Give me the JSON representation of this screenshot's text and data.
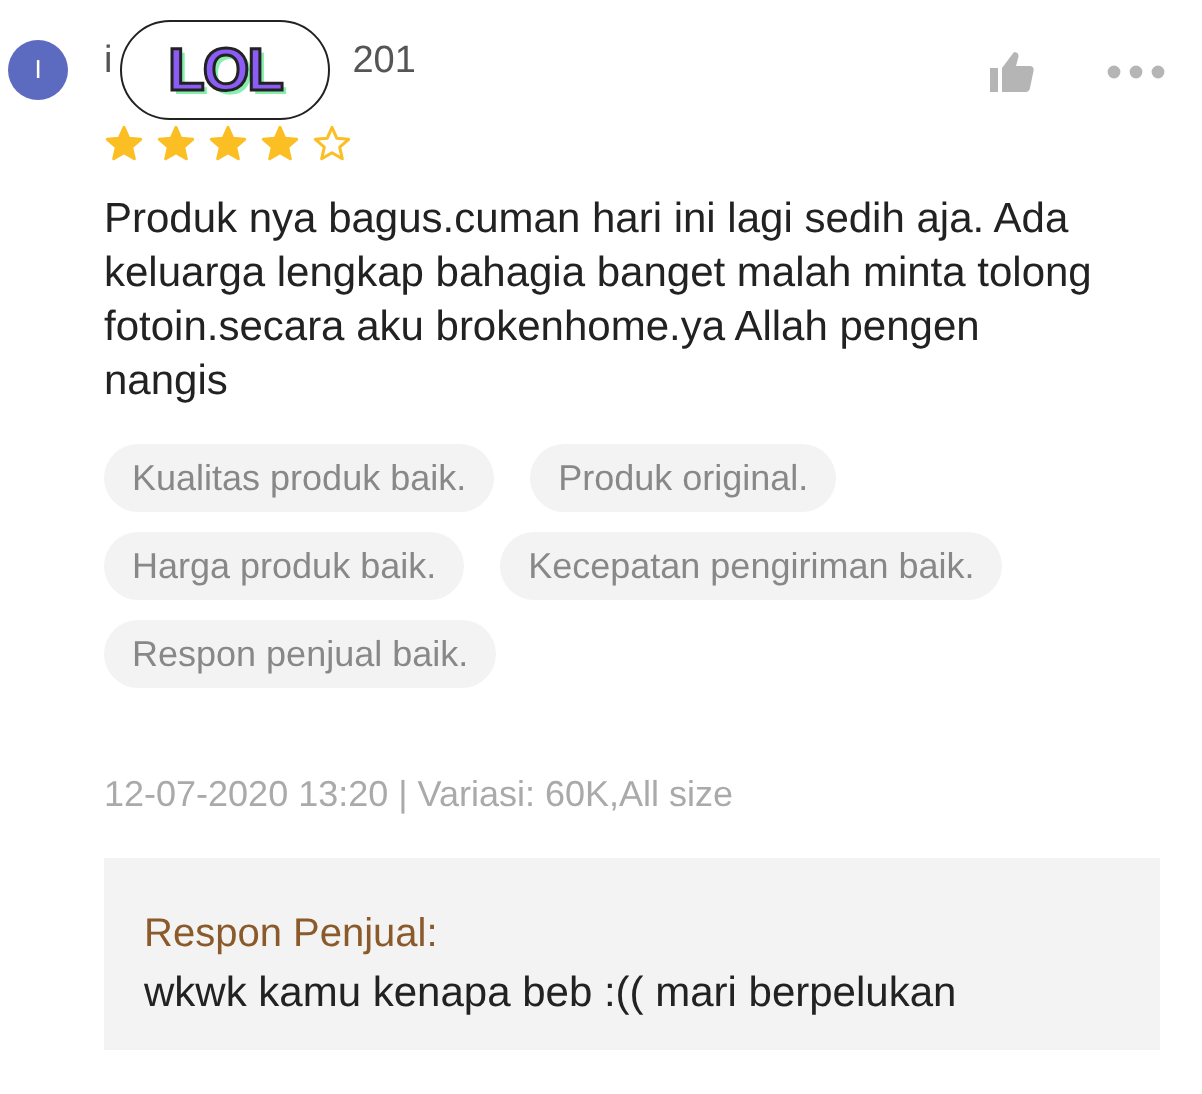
{
  "review": {
    "avatar_letter": "I",
    "username_start": "i",
    "username_end": "201",
    "sticker": "LOL",
    "stars": 4,
    "text": "Produk nya bagus.cuman hari ini lagi sedih aja. Ada keluarga lengkap bahagia banget malah minta tolong fotoin.secara aku brokenhome.ya Allah pengen nangis",
    "tags": [
      [
        "Kualitas produk baik.",
        "Produk original."
      ],
      [
        "Harga produk baik.",
        "Kecepatan pengiriman baik."
      ],
      [
        "Respon penjual baik."
      ]
    ],
    "meta": "12-07-2020 13:20 | Variasi: 60K,All size",
    "seller_reply": {
      "title": "Respon Penjual:",
      "text": "wkwk kamu kenapa beb :(( mari berpelukan"
    }
  }
}
